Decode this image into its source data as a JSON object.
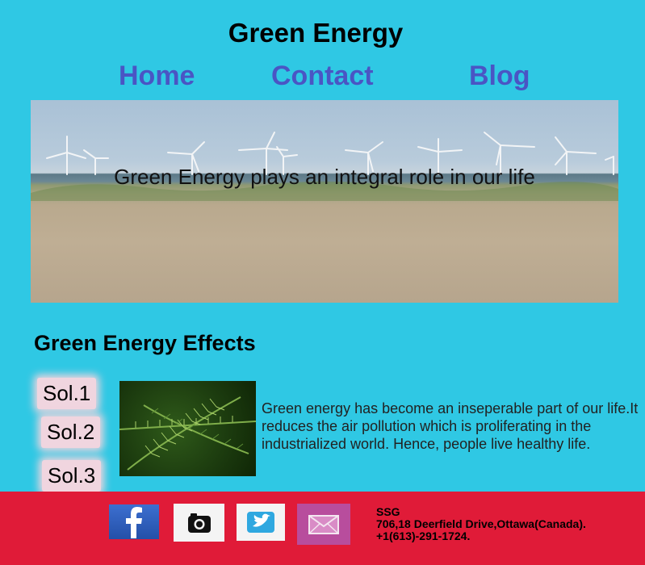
{
  "header": {
    "title": "Green Energy"
  },
  "nav": {
    "home": "Home",
    "contact": "Contact",
    "blog": "Blog"
  },
  "hero": {
    "caption": "Green Energy plays an integral role in our life"
  },
  "section": {
    "heading": "Green Energy Effects"
  },
  "solutions": {
    "sol1": "Sol.1",
    "sol2": "Sol.2",
    "sol3": "Sol.3"
  },
  "effect": {
    "text": "Green energy has become an inseperable part of our life.It reduces the air pollution which is proliferating in the industrialized world. Hence, people live healthy life."
  },
  "footer": {
    "company": "SSG",
    "address": "706,18 Deerfield Drive,Ottawa(Canada).",
    "phone": "+1(613)-291-1724.",
    "icons": [
      "facebook-icon",
      "instagram-icon",
      "twitter-icon",
      "mail-icon"
    ],
    "background_color": "#e01b38"
  },
  "colors": {
    "page_background": "#2fc8e4",
    "nav_link": "#4a55c4"
  }
}
